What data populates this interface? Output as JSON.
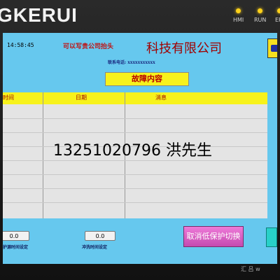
{
  "device": {
    "brand": "GKERUI",
    "indicators": [
      "HMI",
      "RUN",
      "ER"
    ]
  },
  "header": {
    "time": "14:58:45",
    "company_red": "可以写贵公司抬头",
    "company_big": "科技有限公司",
    "contact": "联系电话: xxxxxxxxxxx"
  },
  "fault": {
    "title": "故障内容",
    "columns": [
      "时间",
      "日期",
      "消息"
    ]
  },
  "overlay": {
    "phone": "13251020796 洪先生"
  },
  "controls": {
    "field1_value": "0.0",
    "field1_label": "护源时间设定",
    "field2_value": "0.0",
    "field2_label": "冲洗时间设定",
    "cancel_button": "取消低保护切换"
  },
  "footer_mark": "汇 吕 w"
}
